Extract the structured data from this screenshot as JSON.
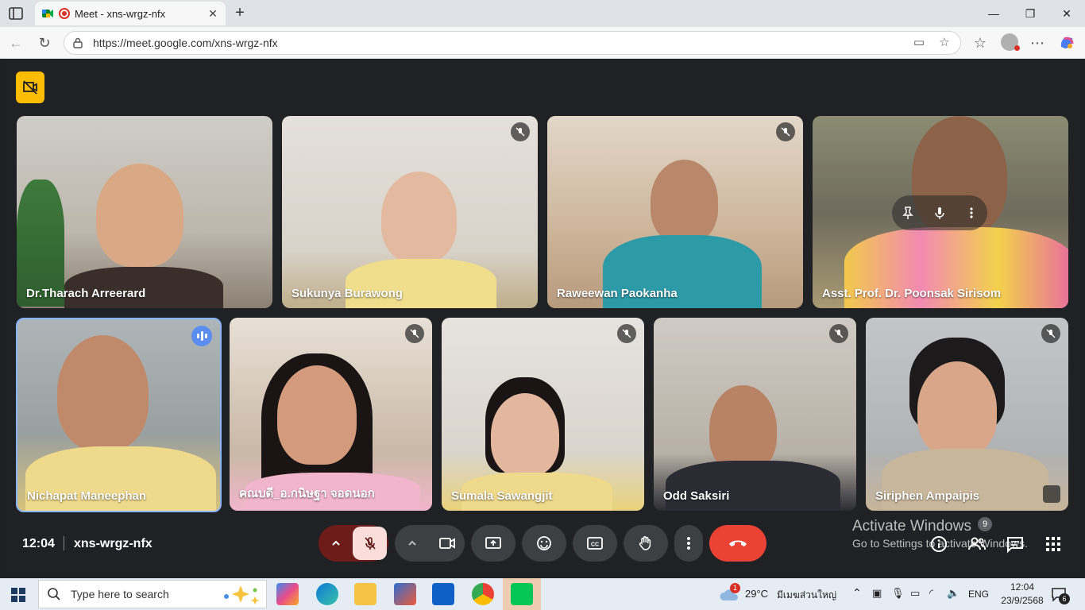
{
  "browser": {
    "tab_title": "Meet - xns-wrgz-nfx",
    "url": "https://meet.google.com/xns-wrgz-nfx"
  },
  "meeting": {
    "time": "12:04",
    "code": "xns-wrgz-nfx",
    "activate_title": "Activate Windows",
    "activate_sub": "Go to Settings to activate Windows.",
    "participant_count": "9"
  },
  "participants": [
    {
      "name": "Dr.Tharach Arreerard",
      "muted": false
    },
    {
      "name": "Sukunya Burawong",
      "muted": true
    },
    {
      "name": "Raweewan Paokanha",
      "muted": true
    },
    {
      "name": "Asst. Prof. Dr. Poonsak Sirisom",
      "muted": false
    },
    {
      "name": "Nichapat Maneephan",
      "muted": false,
      "speaking": true
    },
    {
      "name": "คณบดี_อ.กนิษฐา จอดนอก",
      "muted": true
    },
    {
      "name": "Sumala Sawangjit",
      "muted": true
    },
    {
      "name": "Odd Saksiri",
      "muted": true
    },
    {
      "name": "Siriphen Ampaipis",
      "muted": true
    }
  ],
  "taskbar": {
    "search_placeholder": "Type here to search",
    "weather": "29°C",
    "weather_loc": "มีเมฆส่วนใหญ่",
    "weather_alert": "1",
    "lang": "ENG",
    "clock_time": "12:04",
    "clock_date": "23/9/2568",
    "notif_count": "6"
  },
  "colors": {
    "meet_bg": "#202124",
    "control_bg": "#3c4043",
    "end_call": "#ea4335",
    "mic_off_bg": "#f9dedc",
    "accent_yellow": "#fbbc04",
    "speaking_blue": "#5b8def"
  }
}
